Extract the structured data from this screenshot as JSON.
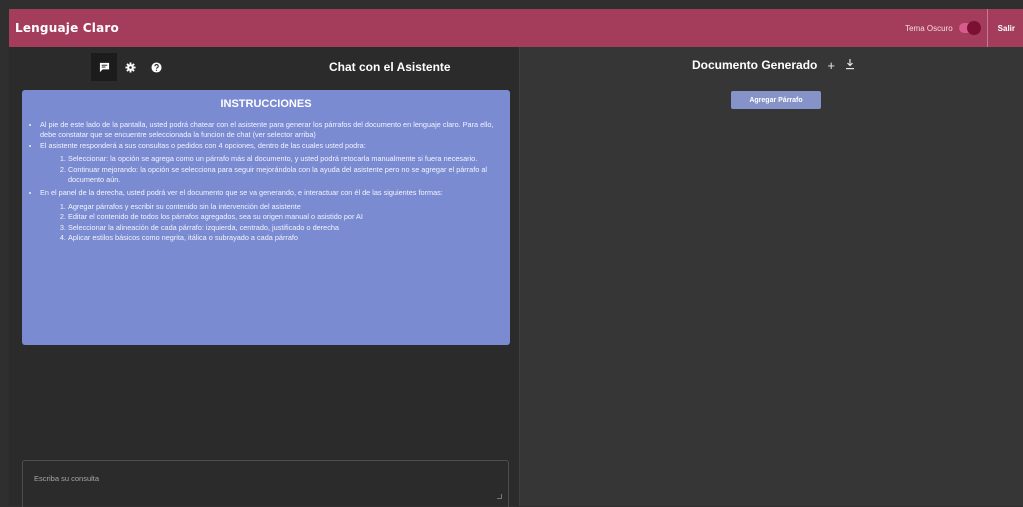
{
  "header": {
    "app_title": "Lenguaje Claro",
    "theme_label": "Tema Oscuro",
    "logout_label": "Salir",
    "accent_color": "#a43d5b"
  },
  "left": {
    "tabs": [
      {
        "icon": "chat-icon"
      },
      {
        "icon": "gear-icon"
      },
      {
        "icon": "help-icon"
      }
    ],
    "chat_title": "Chat con el Asistente",
    "instructions": {
      "title": "INSTRUCCIONES",
      "b1": "Al pie de este lado de la pantalla, usted podrá chatear con el asistente para generar los párrafos del documento en lenguaje claro. Para ello, debe constatar que se encuentre seleccionada la funcion de chat (ver selector arriba)",
      "b2": "El asistente responderá a sus consultas o pedidos con 4 opciones, dentro de las cuales usted podra:",
      "b2_1": "Seleccionar: la opción se agrega como un párrafo más al documento, y usted podrá retocarla manualmente si fuera necesario.",
      "b2_2": "Continuar mejorando: la opción se selecciona para seguir mejorándola con la ayuda del asistente pero no se agregar el párrafo al documento aún.",
      "b3": "En el panel de la derecha, usted podrá ver el documento que se va generando, e interactuar con él de las siguientes formas:",
      "b3_1": "Agregar párrafos y escribir su contenido sin la intervención del asistente",
      "b3_2": "Editar el contenido de todos los párrafos agregados, sea su origen manual o asistido por AI",
      "b3_3": "Seleccionar la alineación de cada párrafo: izquierda, centrado, justificado o derecha",
      "b3_4": "Aplicar estilos básicos como negrita, itálica o subrayado a cada párrafo"
    },
    "input_placeholder": "Escriba su consulta"
  },
  "right": {
    "doc_title": "Documento Generado",
    "add_symbol": "+",
    "add_paragraph_label": "Agregar Párrafo"
  }
}
